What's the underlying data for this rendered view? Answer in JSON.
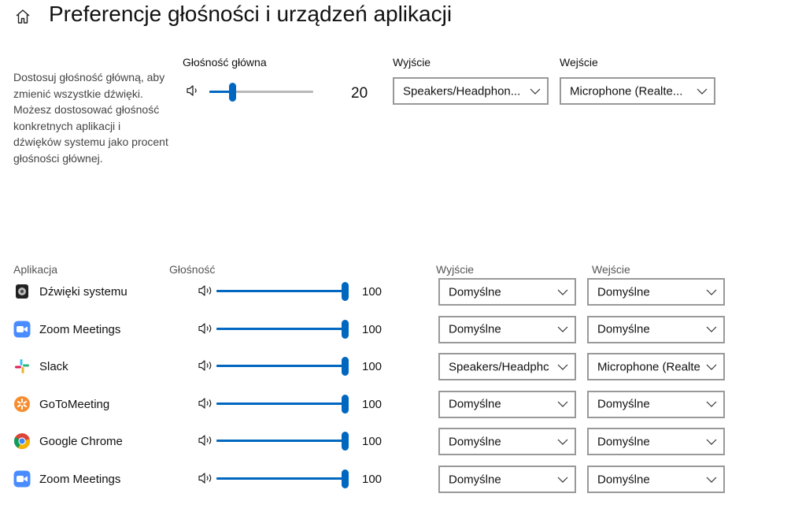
{
  "header": {
    "title": "Preferencje głośności i urządzeń aplikacji",
    "home_icon": "home-icon"
  },
  "master": {
    "description": "Dostosuj głośność główną, aby zmienić wszystkie dźwięki. Możesz dostosować głośność konkretnych aplikacji i dźwięków systemu jako procent głośności głównej.",
    "volume_label": "Głośność główna",
    "volume_value": "20",
    "volume_level": 20,
    "output_label": "Wyjście",
    "output_value": "Speakers/Headphon...",
    "input_label": "Wejście",
    "input_value": "Microphone (Realte..."
  },
  "apps": {
    "col_app": "Aplikacja",
    "col_volume": "Głośność",
    "col_output": "Wyjście",
    "col_input": "Wejście",
    "rows": [
      {
        "name": "Dźwięki systemu",
        "icon": "system-sounds-icon",
        "volume": "100",
        "level": 100,
        "output": "Domyślne",
        "input": "Domyślne"
      },
      {
        "name": "Zoom Meetings",
        "icon": "zoom-icon",
        "volume": "100",
        "level": 100,
        "output": "Domyślne",
        "input": "Domyślne"
      },
      {
        "name": "Slack",
        "icon": "slack-icon",
        "volume": "100",
        "level": 100,
        "output": "Speakers/Headphc",
        "input": "Microphone (Realte"
      },
      {
        "name": "GoToMeeting",
        "icon": "gotomeeting-icon",
        "volume": "100",
        "level": 100,
        "output": "Domyślne",
        "input": "Domyślne"
      },
      {
        "name": "Google Chrome",
        "icon": "chrome-icon",
        "volume": "100",
        "level": 100,
        "output": "Domyślne",
        "input": "Domyślne"
      },
      {
        "name": "Zoom Meetings",
        "icon": "zoom-icon",
        "volume": "100",
        "level": 100,
        "output": "Domyślne",
        "input": "Domyślne"
      }
    ]
  },
  "colors": {
    "accent": "#0067c0",
    "track": "#b8b8b8",
    "dropdown_border": "#999999"
  }
}
